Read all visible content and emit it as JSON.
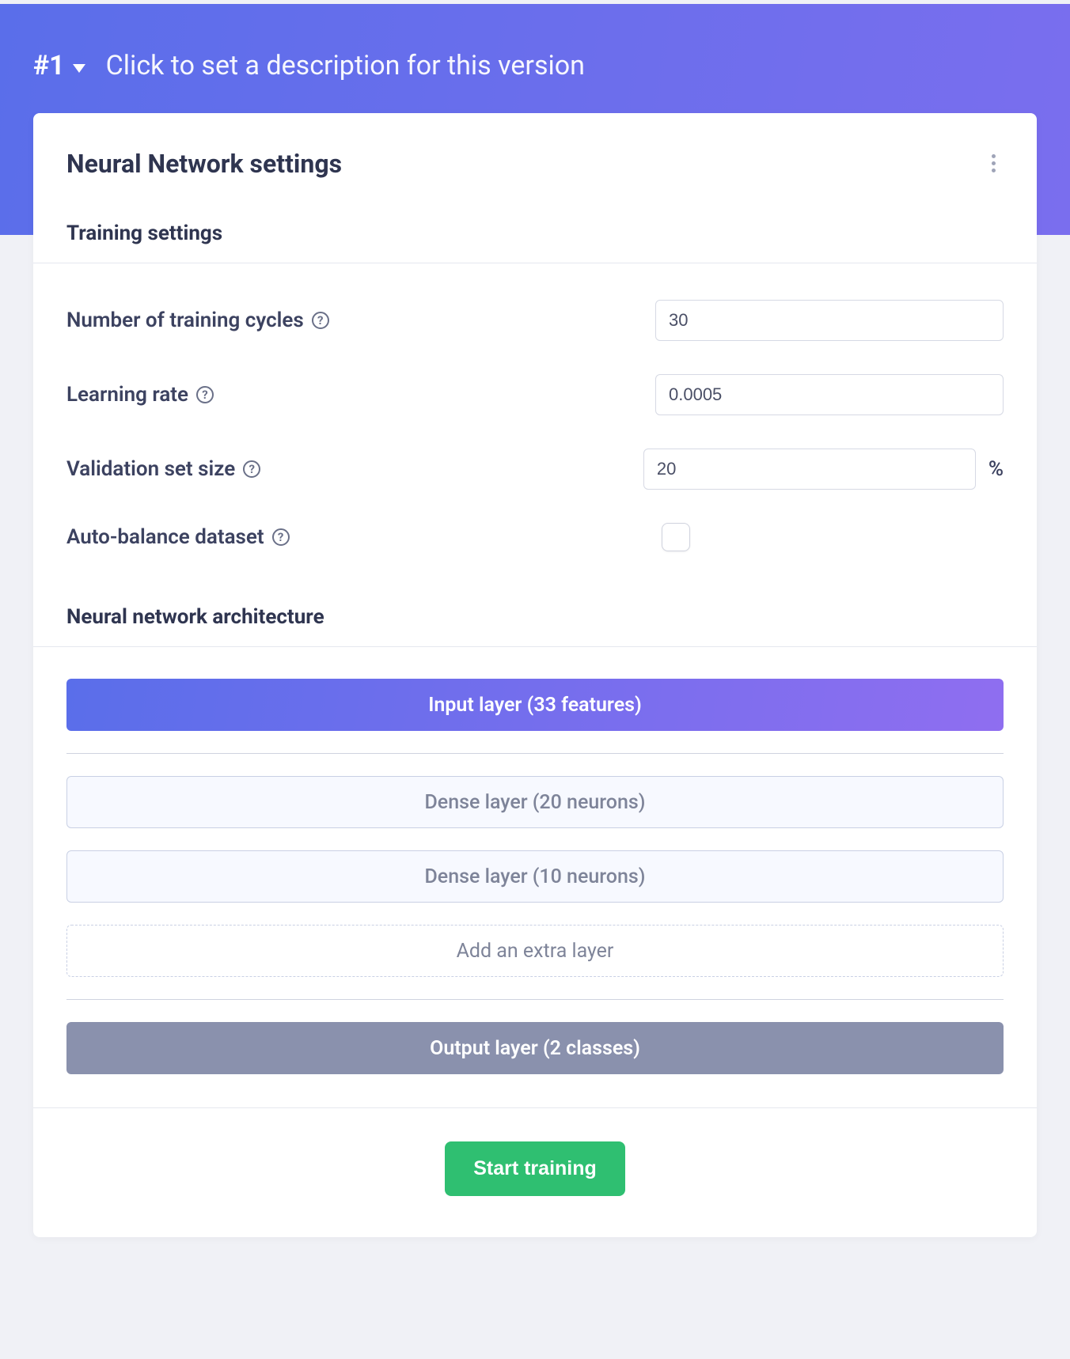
{
  "header": {
    "version_label": "#1",
    "description_placeholder": "Click to set a description for this version"
  },
  "card": {
    "title": "Neural Network settings"
  },
  "training": {
    "section_title": "Training settings",
    "cycles_label": "Number of training cycles",
    "cycles_value": "30",
    "lr_label": "Learning rate",
    "lr_value": "0.0005",
    "valset_label": "Validation set size",
    "valset_value": "20",
    "valset_unit": "%",
    "autobalance_label": "Auto-balance dataset",
    "autobalance_checked": false
  },
  "architecture": {
    "section_title": "Neural network architecture",
    "input_layer": "Input layer (33 features)",
    "dense1": "Dense layer (20 neurons)",
    "dense2": "Dense layer (10 neurons)",
    "add_layer": "Add an extra layer",
    "output_layer": "Output layer (2 classes)"
  },
  "actions": {
    "start_training": "Start training"
  }
}
